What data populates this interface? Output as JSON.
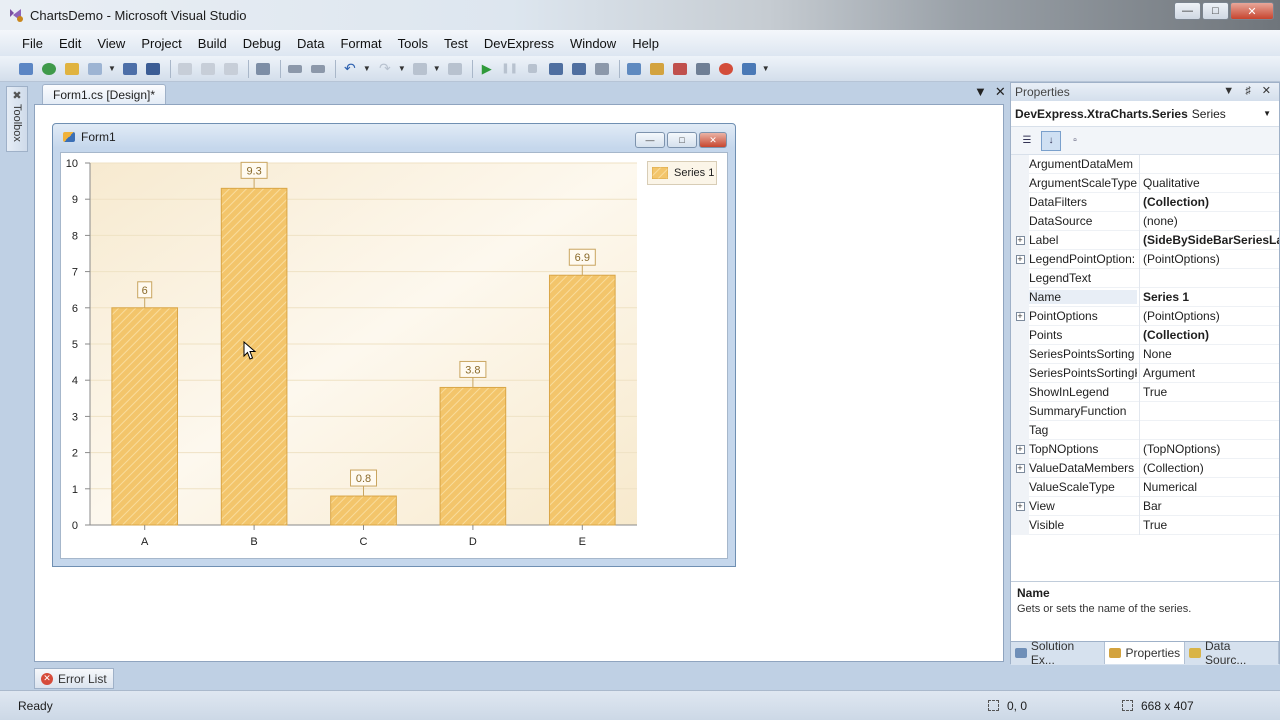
{
  "window": {
    "title": "ChartsDemo - Microsoft Visual Studio",
    "buttons": [
      "minimize",
      "maximize",
      "close"
    ]
  },
  "menu": [
    "File",
    "Edit",
    "View",
    "Project",
    "Build",
    "Debug",
    "Data",
    "Format",
    "Tools",
    "Test",
    "DevExpress",
    "Window",
    "Help"
  ],
  "toolbar": {
    "icons": [
      "new-project-icon",
      "add-item-icon",
      "open-file-icon",
      "add-new-item-icon",
      "save-icon",
      "save-all-icon",
      "cut-icon",
      "copy-icon",
      "paste-icon",
      "find-icon",
      "comment-icon",
      "uncomment-icon",
      "undo-icon",
      "redo-icon",
      "navigate-back-icon",
      "navigate-forward-icon",
      "start-debugging-icon",
      "pause-icon",
      "stop-icon",
      "step-into-icon",
      "step-over-icon",
      "step-out-icon",
      "solution-explorer-icon",
      "properties-icon",
      "object-browser-icon",
      "toolbox-icon",
      "error-list-icon",
      "immediate-window-icon",
      "overflow-icon"
    ]
  },
  "toolbox": {
    "label": "Toolbox"
  },
  "document": {
    "tab_label": "Form1.cs [Design]*"
  },
  "form": {
    "title": "Form1"
  },
  "chart_data": {
    "type": "bar",
    "categories": [
      "A",
      "B",
      "C",
      "D",
      "E"
    ],
    "series": [
      {
        "name": "Series 1",
        "values": [
          6,
          9.3,
          0.8,
          3.8,
          6.9
        ]
      }
    ],
    "data_labels": [
      "6",
      "9.3",
      "0.8",
      "3.8",
      "6.9"
    ],
    "y_ticks": [
      "0",
      "1",
      "2",
      "3",
      "4",
      "5",
      "6",
      "7",
      "8",
      "9",
      "10"
    ],
    "ylim": [
      0,
      10
    ],
    "legend_position": "top-right",
    "bar_color": "#f0c36a",
    "bar_hatch_color": "#e0a840",
    "background_color": "#fbf0da",
    "grid": true,
    "title": "",
    "xlabel": "",
    "ylabel": ""
  },
  "properties": {
    "header": "Properties",
    "object_name": "DevExpress.XtraCharts.Series",
    "object_type": "Series",
    "rows": [
      {
        "name": "ArgumentDataMem",
        "value": "",
        "expandable": false,
        "bold": false
      },
      {
        "name": "ArgumentScaleType",
        "value": "Qualitative",
        "expandable": false,
        "bold": false
      },
      {
        "name": "DataFilters",
        "value": "(Collection)",
        "expandable": false,
        "bold": true
      },
      {
        "name": "DataSource",
        "value": "(none)",
        "expandable": false,
        "bold": false
      },
      {
        "name": "Label",
        "value": "(SideBySideBarSeriesLa",
        "expandable": true,
        "bold": true
      },
      {
        "name": "LegendPointOption:",
        "value": "(PointOptions)",
        "expandable": true,
        "bold": false
      },
      {
        "name": "LegendText",
        "value": "",
        "expandable": false,
        "bold": false
      },
      {
        "name": "Name",
        "value": "Series 1",
        "expandable": false,
        "bold": true,
        "selected": true
      },
      {
        "name": "PointOptions",
        "value": "(PointOptions)",
        "expandable": true,
        "bold": false
      },
      {
        "name": "Points",
        "value": "(Collection)",
        "expandable": false,
        "bold": true
      },
      {
        "name": "SeriesPointsSorting",
        "value": "None",
        "expandable": false,
        "bold": false
      },
      {
        "name": "SeriesPointsSortingK",
        "value": "Argument",
        "expandable": false,
        "bold": false
      },
      {
        "name": "ShowInLegend",
        "value": "True",
        "expandable": false,
        "bold": false
      },
      {
        "name": "SummaryFunction",
        "value": "",
        "expandable": false,
        "bold": false
      },
      {
        "name": "Tag",
        "value": "",
        "expandable": false,
        "bold": false
      },
      {
        "name": "TopNOptions",
        "value": "(TopNOptions)",
        "expandable": true,
        "bold": false
      },
      {
        "name": "ValueDataMembers",
        "value": "(Collection)",
        "expandable": true,
        "bold": false
      },
      {
        "name": "ValueScaleType",
        "value": "Numerical",
        "expandable": false,
        "bold": false
      },
      {
        "name": "View",
        "value": "Bar",
        "expandable": true,
        "bold": false
      },
      {
        "name": "Visible",
        "value": "True",
        "expandable": false,
        "bold": false
      }
    ],
    "description": {
      "title": "Name",
      "text": "Gets or sets the name of the series."
    }
  },
  "panel_tabs": [
    "Solution Ex...",
    "Properties",
    "Data Sourc..."
  ],
  "error_list": {
    "label": "Error List"
  },
  "status": {
    "ready": "Ready",
    "position": "0, 0",
    "size": "668 x 407"
  }
}
